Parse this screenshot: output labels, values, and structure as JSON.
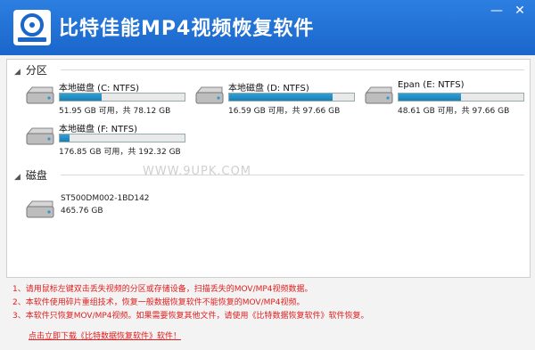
{
  "app": {
    "title": "比特佳能MP4视频恢复软件"
  },
  "window_controls": {
    "minimize": "—",
    "close": "✕"
  },
  "sections": {
    "partitions": "分区",
    "disks": "磁盘"
  },
  "partitions": [
    {
      "name": "本地磁盘 (C: NTFS)",
      "size": "51.95 GB 可用，共 78.12 GB",
      "usage": 0.335
    },
    {
      "name": "本地磁盘 (D: NTFS)",
      "size": "16.59 GB 可用，共 97.66 GB",
      "usage": 0.83
    },
    {
      "name": "Epan (E: NTFS)",
      "size": "48.61 GB 可用，共 97.66 GB",
      "usage": 0.5
    },
    {
      "name": "本地磁盘 (F: NTFS)",
      "size": "176.85 GB 可用，共 192.32 GB",
      "usage": 0.08
    }
  ],
  "disks": [
    {
      "name": "ST500DM002-1BD142",
      "size": "465.76 GB"
    }
  ],
  "watermark": "WWW.9UPK.COM",
  "notes": [
    "1、请用鼠标左键双击丢失视频的分区或存储设备，扫描丢失的MOV/MP4视频数据。",
    "2、本软件使用碎片重组技术，恢复一般数据恢复软件不能恢复的MOV/MP4视频。",
    "3、本软件只恢复MOV/MP4视频。如果需要恢复其他文件，请使用《比特数据恢复软件》软件恢复。"
  ],
  "download_link": "点击立即下载《比特数据恢复软件》软件！",
  "colors": {
    "titlebar": "#1a66cc",
    "bar_fill": "#1a7fb5",
    "note_text": "#e01e1e"
  }
}
